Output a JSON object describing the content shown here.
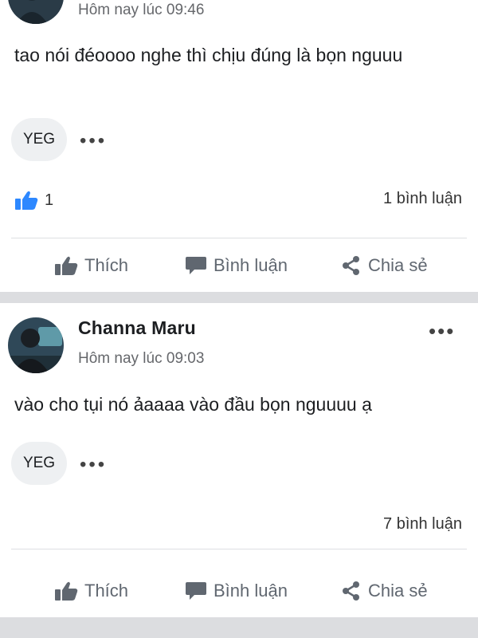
{
  "colors": {
    "background": "#ffffff",
    "separator": "#dcdde0",
    "like_blue": "#2d88ff",
    "muted": "#65676b",
    "chip_bg": "#eef0f2"
  },
  "icons": {
    "like": "thumbs-up-icon",
    "comment": "comment-bubble-icon",
    "share": "share-icon",
    "more": "more-dots-icon",
    "reaction": "like-reaction-icon"
  },
  "posts": [
    {
      "author": "",
      "time": "Hôm nay lúc 09:46",
      "text": "tao nói đéoooo nghe thì chịu đúng là bọn nguuu",
      "chip": "YEG",
      "chip_more": "•••",
      "likes": "1",
      "comments": "1 bình luận"
    },
    {
      "author": "Channa Maru",
      "more": "•••",
      "time": "Hôm nay lúc 09:03",
      "text": "vào cho tụi nó ảaaaa vào đầu bọn nguuuu ạ",
      "chip": "YEG",
      "chip_more": "•••",
      "likes": "",
      "comments": "7 bình luận"
    }
  ],
  "actions": {
    "like": "Thích",
    "comment": "Bình luận",
    "share": "Chia sẻ"
  }
}
